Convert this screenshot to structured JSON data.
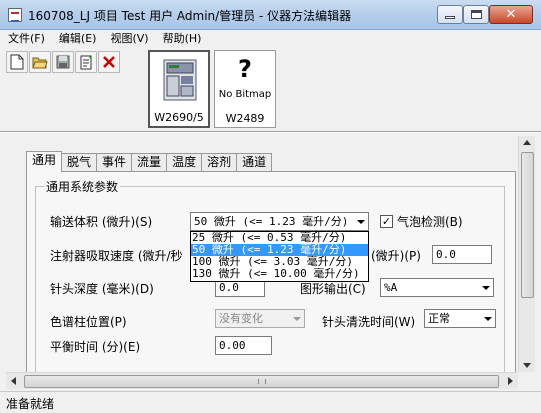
{
  "window": {
    "title": "160708_LJ 项目 Test 用户 Admin/管理员 - 仪器方法编辑器"
  },
  "menu": [
    {
      "label": "文件(F)"
    },
    {
      "label": "编辑(E)"
    },
    {
      "label": "视图(V)"
    },
    {
      "label": "帮助(H)"
    }
  ],
  "toolbar": {
    "icons": [
      "new-document-icon",
      "open-folder-icon",
      "save-disk-icon",
      "properties-icon",
      "delete-x-icon"
    ]
  },
  "modules": [
    {
      "label": "W2690/5"
    },
    {
      "label": "W2489",
      "placeholder_mark": "?",
      "placeholder_text": "No Bitmap"
    }
  ],
  "tabs": [
    {
      "label": "通用"
    },
    {
      "label": "脱气"
    },
    {
      "label": "事件"
    },
    {
      "label": "流量"
    },
    {
      "label": "温度"
    },
    {
      "label": "溶剂"
    },
    {
      "label": "通道"
    }
  ],
  "group": {
    "title": "通用系统参数"
  },
  "form": {
    "delivery_volume": {
      "label": "输送体积 (微升)(S)",
      "value": "50 微升 (<= 1.23 毫升/分)",
      "options": [
        "25 微升 (<= 0.53 毫升/分)",
        "50 微升 (<= 1.23 毫升/分)",
        "100 微升 (<= 3.03 毫升/分)",
        "130 微升 (<= 10.00 毫升/分)"
      ],
      "selected_index": 1
    },
    "bubble_detect": {
      "label": "气泡检测(B)",
      "checked": true,
      "mark": "✓"
    },
    "syringe_draw_rate": {
      "label": "注射器吸取速度 (微升/秒",
      "suffix": "(微升)(P)",
      "value": "0.0"
    },
    "needle_depth": {
      "label": "针头深度 (毫米)(D)",
      "value": "0.0"
    },
    "graphic_output": {
      "label": "图形输出(C)",
      "value": "%A"
    },
    "column_position": {
      "label": "色谱柱位置(P)",
      "value": "没有变化"
    },
    "needle_wash_time": {
      "label": "针头清洗时间(W)",
      "value": "正常"
    },
    "equilibration_time": {
      "label": "平衡时间 (分)(E)",
      "value": "0.00"
    }
  },
  "status": {
    "text": "准备就绪"
  }
}
